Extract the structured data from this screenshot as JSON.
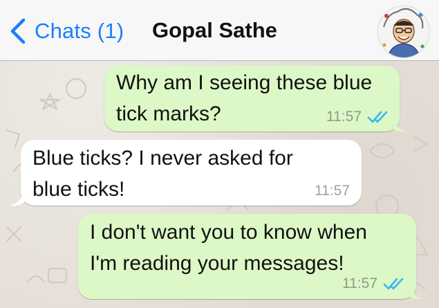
{
  "header": {
    "back_label": "Chats (1)",
    "contact_name": "Gopal Sathe",
    "accent_color": "#1a7ffb",
    "back_icon": "chevron-left-icon",
    "avatar_icon": "caricature-avatar"
  },
  "messages": [
    {
      "direction": "outgoing",
      "text": "Why am I seeing these blue\ntick marks?",
      "time": "11:57",
      "status": "read",
      "status_icon": "double-check-icon"
    },
    {
      "direction": "incoming",
      "text": "Blue ticks? I never asked for\nblue ticks!",
      "time": "11:57"
    },
    {
      "direction": "outgoing",
      "text": "I don't want you to know when\nI'm reading your messages!",
      "time": "11:57",
      "status": "read",
      "status_icon": "double-check-icon"
    }
  ],
  "colors": {
    "outgoing_bubble": "#dcf8c6",
    "incoming_bubble": "#ffffff",
    "read_ticks": "#34b7f1",
    "wallpaper": "#e4ded6",
    "navbar": "#f7f7f7"
  }
}
